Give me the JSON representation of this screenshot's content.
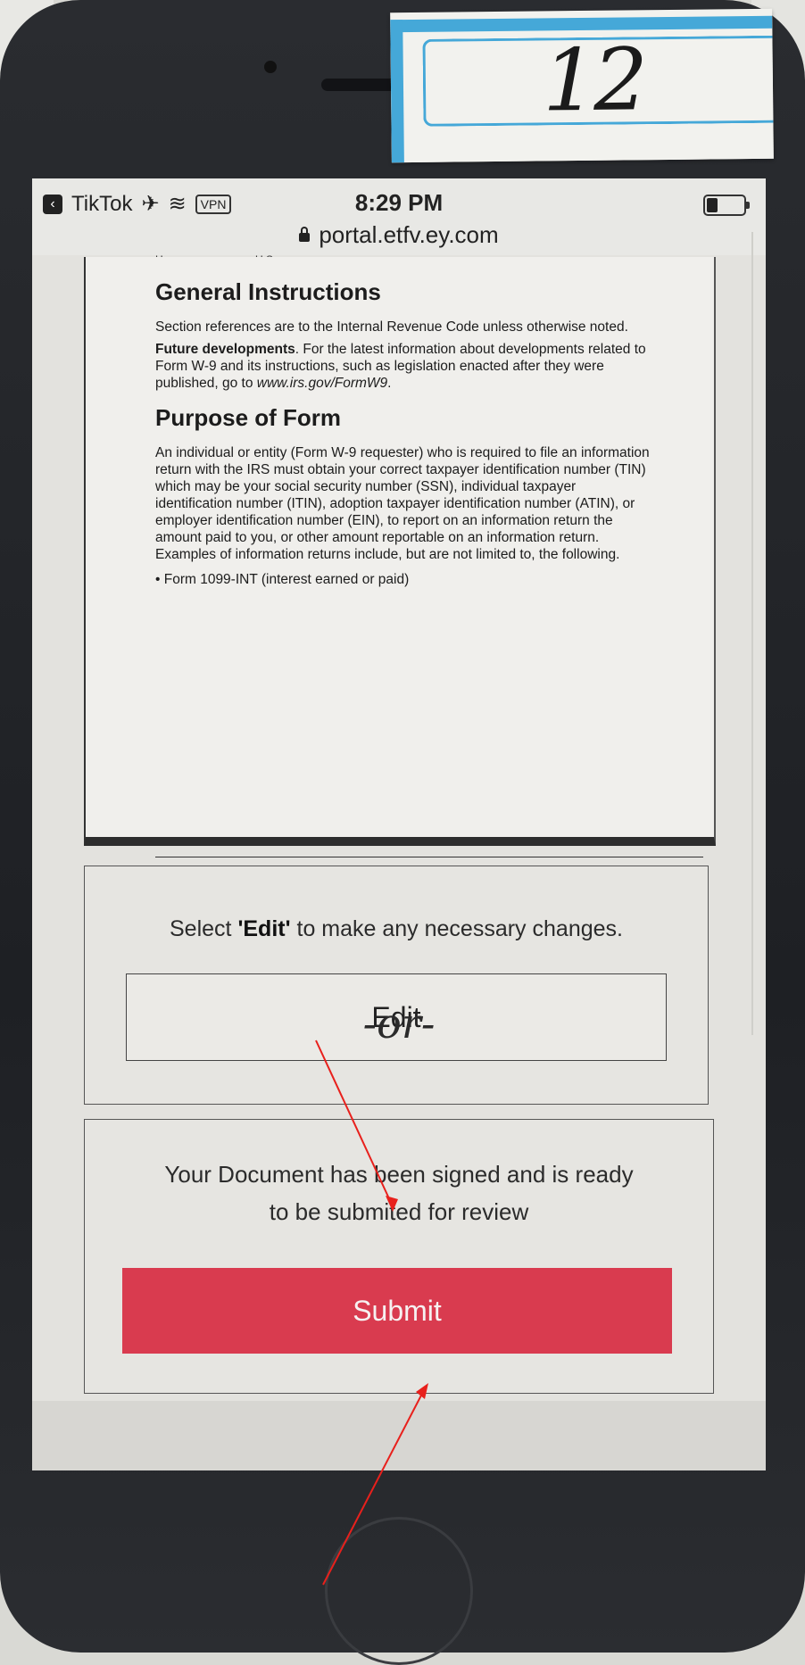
{
  "sticker": {
    "number": "12"
  },
  "status_bar": {
    "back_app": "TikTok",
    "vpn_label": "VPN",
    "time": "8:29 PM"
  },
  "url_bar": {
    "url": "portal.etfv.ey.com"
  },
  "document": {
    "cut_left": "Here",
    "cut_right": "U.S. person ▸",
    "heading_1": "General Instructions",
    "para_1": "Section references are to the Internal Revenue Code unless otherwise noted.",
    "para_2_bold": "Future developments",
    "para_2": ". For the latest information about developments related to Form W-9 and its instructions, such as legislation enacted after they were published, go to ",
    "para_2_link": "www.irs.gov/FormW9",
    "para_2_end": ".",
    "heading_2": "Purpose of Form",
    "para_3": "An individual or entity (Form W-9 requester) who is required to file an information return with the IRS must obtain your correct taxpayer identification number (TIN) which may be your social security number (SSN), individual taxpayer identification number (ITIN), adoption taxpayer identification number (ATIN), or employer identification number (EIN), to report on an information return the amount paid to you, or other amount reportable on an information return. Examples of information returns include, but are not limited to, the following.",
    "bullet_1": "• Form 1099-INT (interest earned or paid)"
  },
  "edit_panel": {
    "prompt_prefix": "Select ",
    "prompt_bold": "'Edit'",
    "prompt_suffix": " to make any necessary changes.",
    "edit_label": "Edit"
  },
  "separator": "-or-",
  "submit_panel": {
    "message_line_1": "Your Document has been signed and is ready",
    "message_line_2": "to be submited for review",
    "submit_label": "Submit"
  },
  "colors": {
    "submit_bg": "#d93b4f",
    "annotation_arrow": "#e8201c",
    "sticker_band": "#45a8d8"
  }
}
